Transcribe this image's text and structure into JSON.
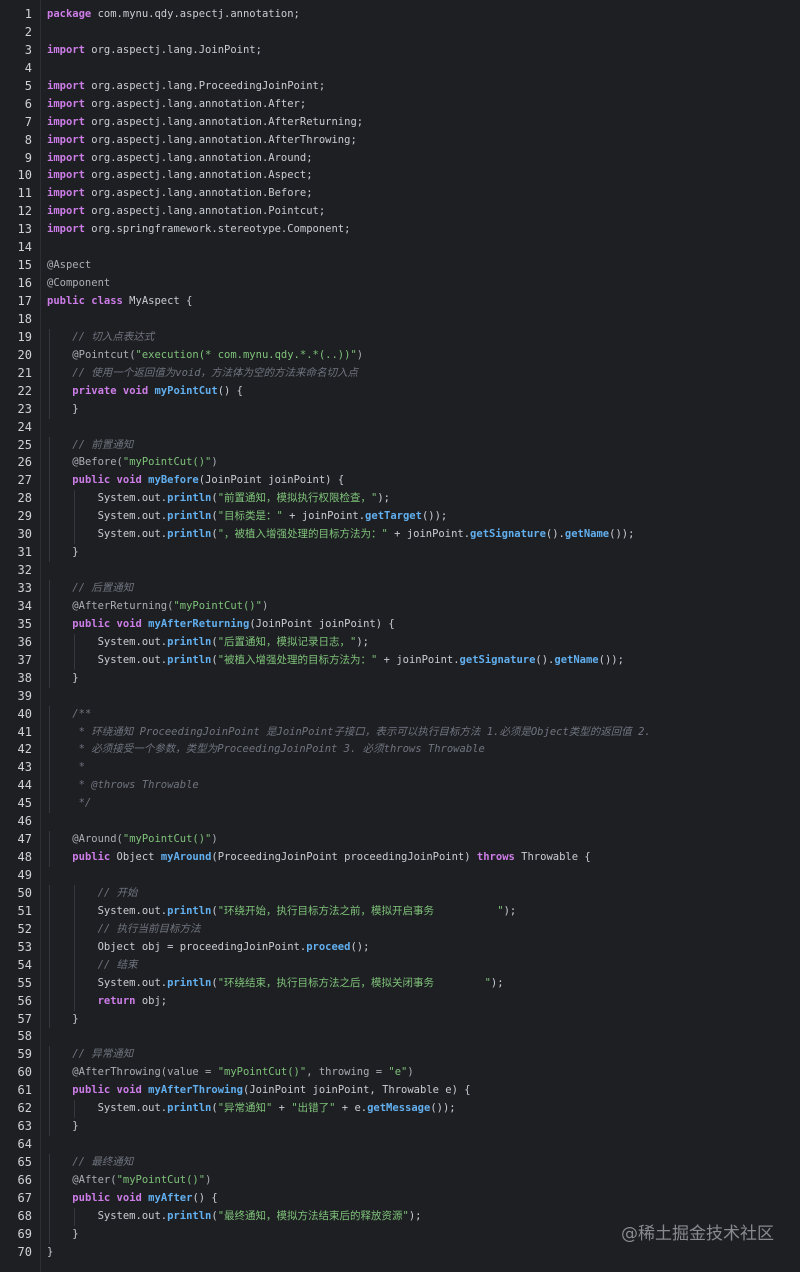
{
  "editor": {
    "language": "java",
    "theme_colors": {
      "background": "#1e1f22",
      "keyword": "#cc7de8",
      "string": "#7ec27a",
      "comment": "#6f7480",
      "method": "#61afef",
      "text": "#c8ccd4",
      "line_number": "#cfd2d6"
    },
    "lines": [
      [
        {
          "t": "package",
          "c": "kw"
        },
        {
          "t": " com.mynu.qdy.aspectj.annotation;"
        }
      ],
      [],
      [
        {
          "t": "import",
          "c": "kw"
        },
        {
          "t": " org.aspectj.lang.JoinPoint;"
        }
      ],
      [],
      [
        {
          "t": "import",
          "c": "kw"
        },
        {
          "t": " org.aspectj.lang.ProceedingJoinPoint;"
        }
      ],
      [
        {
          "t": "import",
          "c": "kw"
        },
        {
          "t": " org.aspectj.lang.annotation.After;"
        }
      ],
      [
        {
          "t": "import",
          "c": "kw"
        },
        {
          "t": " org.aspectj.lang.annotation.AfterReturning;"
        }
      ],
      [
        {
          "t": "import",
          "c": "kw"
        },
        {
          "t": " org.aspectj.lang.annotation.AfterThrowing;"
        }
      ],
      [
        {
          "t": "import",
          "c": "kw"
        },
        {
          "t": " org.aspectj.lang.annotation.Around;"
        }
      ],
      [
        {
          "t": "import",
          "c": "kw"
        },
        {
          "t": " org.aspectj.lang.annotation.Aspect;"
        }
      ],
      [
        {
          "t": "import",
          "c": "kw"
        },
        {
          "t": " org.aspectj.lang.annotation.Before;"
        }
      ],
      [
        {
          "t": "import",
          "c": "kw"
        },
        {
          "t": " org.aspectj.lang.annotation.Pointcut;"
        }
      ],
      [
        {
          "t": "import",
          "c": "kw"
        },
        {
          "t": " org.springframework.stereotype.Component;"
        }
      ],
      [],
      [
        {
          "t": "@Aspect",
          "c": "ann"
        }
      ],
      [
        {
          "t": "@Component",
          "c": "ann"
        }
      ],
      [
        {
          "t": "public class",
          "c": "kw"
        },
        {
          "t": " MyAspect {"
        }
      ],
      [],
      [
        {
          "t": "    "
        },
        {
          "t": "// 切入点表达式",
          "c": "com"
        }
      ],
      [
        {
          "t": "    "
        },
        {
          "t": "@Pointcut(",
          "c": "ann"
        },
        {
          "t": "\"execution(* com.mynu.qdy.*.*(..))\"",
          "c": "str"
        },
        {
          "t": ")",
          "c": "ann"
        }
      ],
      [
        {
          "t": "    "
        },
        {
          "t": "// 使用一个返回值为void，方法体为空的方法来命名切入点",
          "c": "com"
        }
      ],
      [
        {
          "t": "    "
        },
        {
          "t": "private void",
          "c": "kw"
        },
        {
          "t": " "
        },
        {
          "t": "myPointCut",
          "c": "fn"
        },
        {
          "t": "() {"
        }
      ],
      [
        {
          "t": "    }"
        }
      ],
      [],
      [
        {
          "t": "    "
        },
        {
          "t": "// 前置通知",
          "c": "com"
        }
      ],
      [
        {
          "t": "    "
        },
        {
          "t": "@Before(",
          "c": "ann"
        },
        {
          "t": "\"myPointCut()\"",
          "c": "str"
        },
        {
          "t": ")",
          "c": "ann"
        }
      ],
      [
        {
          "t": "    "
        },
        {
          "t": "public void",
          "c": "kw"
        },
        {
          "t": " "
        },
        {
          "t": "myBefore",
          "c": "fn"
        },
        {
          "t": "(JoinPoint joinPoint) {"
        }
      ],
      [
        {
          "t": "        System.out."
        },
        {
          "t": "println",
          "c": "fn"
        },
        {
          "t": "("
        },
        {
          "t": "\"前置通知，模拟执行权限检查，\"",
          "c": "str"
        },
        {
          "t": ");"
        }
      ],
      [
        {
          "t": "        System.out."
        },
        {
          "t": "println",
          "c": "fn"
        },
        {
          "t": "("
        },
        {
          "t": "\"目标类是：\"",
          "c": "str"
        },
        {
          "t": " + joinPoint."
        },
        {
          "t": "getTarget",
          "c": "fn"
        },
        {
          "t": "());"
        }
      ],
      [
        {
          "t": "        System.out."
        },
        {
          "t": "println",
          "c": "fn"
        },
        {
          "t": "("
        },
        {
          "t": "\"，被植入增强处理的目标方法为：\"",
          "c": "str"
        },
        {
          "t": " + joinPoint."
        },
        {
          "t": "getSignature",
          "c": "fn"
        },
        {
          "t": "()."
        },
        {
          "t": "getName",
          "c": "fn"
        },
        {
          "t": "());"
        }
      ],
      [
        {
          "t": "    }"
        }
      ],
      [],
      [
        {
          "t": "    "
        },
        {
          "t": "// 后置通知",
          "c": "com"
        }
      ],
      [
        {
          "t": "    "
        },
        {
          "t": "@AfterReturning(",
          "c": "ann"
        },
        {
          "t": "\"myPointCut()\"",
          "c": "str"
        },
        {
          "t": ")",
          "c": "ann"
        }
      ],
      [
        {
          "t": "    "
        },
        {
          "t": "public void",
          "c": "kw"
        },
        {
          "t": " "
        },
        {
          "t": "myAfterReturning",
          "c": "fn"
        },
        {
          "t": "(JoinPoint joinPoint) {"
        }
      ],
      [
        {
          "t": "        System.out."
        },
        {
          "t": "println",
          "c": "fn"
        },
        {
          "t": "("
        },
        {
          "t": "\"后置通知，模拟记录日志，\"",
          "c": "str"
        },
        {
          "t": ");"
        }
      ],
      [
        {
          "t": "        System.out."
        },
        {
          "t": "println",
          "c": "fn"
        },
        {
          "t": "("
        },
        {
          "t": "\"被植入增强处理的目标方法为：\"",
          "c": "str"
        },
        {
          "t": " + joinPoint."
        },
        {
          "t": "getSignature",
          "c": "fn"
        },
        {
          "t": "()."
        },
        {
          "t": "getName",
          "c": "fn"
        },
        {
          "t": "());"
        }
      ],
      [
        {
          "t": "    }"
        }
      ],
      [],
      [
        {
          "t": "    "
        },
        {
          "t": "/**",
          "c": "com"
        }
      ],
      [
        {
          "t": "     "
        },
        {
          "t": "* 环绕通知 ProceedingJoinPoint 是JoinPoint子接口，表示可以执行目标方法 1.必须是Object类型的返回值 2.",
          "c": "com"
        }
      ],
      [
        {
          "t": "     "
        },
        {
          "t": "* 必须接受一个参数，类型为ProceedingJoinPoint 3. 必须throws Throwable",
          "c": "com"
        }
      ],
      [
        {
          "t": "     "
        },
        {
          "t": "*",
          "c": "com"
        }
      ],
      [
        {
          "t": "     "
        },
        {
          "t": "* @throws Throwable",
          "c": "com"
        }
      ],
      [
        {
          "t": "     "
        },
        {
          "t": "*/",
          "c": "com"
        }
      ],
      [],
      [
        {
          "t": "    "
        },
        {
          "t": "@Around(",
          "c": "ann"
        },
        {
          "t": "\"myPointCut()\"",
          "c": "str"
        },
        {
          "t": ")",
          "c": "ann"
        }
      ],
      [
        {
          "t": "    "
        },
        {
          "t": "public",
          "c": "kw"
        },
        {
          "t": " Object "
        },
        {
          "t": "myAround",
          "c": "fn"
        },
        {
          "t": "(ProceedingJoinPoint proceedingJoinPoint) "
        },
        {
          "t": "throws",
          "c": "kw"
        },
        {
          "t": " Throwable {"
        }
      ],
      [],
      [
        {
          "t": "        "
        },
        {
          "t": "// 开始",
          "c": "com"
        }
      ],
      [
        {
          "t": "        System.out."
        },
        {
          "t": "println",
          "c": "fn"
        },
        {
          "t": "("
        },
        {
          "t": "\"环绕开始，执行目标方法之前，模拟开启事务          \"",
          "c": "str"
        },
        {
          "t": ");"
        }
      ],
      [
        {
          "t": "        "
        },
        {
          "t": "// 执行当前目标方法",
          "c": "com"
        }
      ],
      [
        {
          "t": "        Object obj = proceedingJoinPoint."
        },
        {
          "t": "proceed",
          "c": "fn"
        },
        {
          "t": "();"
        }
      ],
      [
        {
          "t": "        "
        },
        {
          "t": "// 结束",
          "c": "com"
        }
      ],
      [
        {
          "t": "        System.out."
        },
        {
          "t": "println",
          "c": "fn"
        },
        {
          "t": "("
        },
        {
          "t": "\"环绕结束，执行目标方法之后，模拟关闭事务        \"",
          "c": "str"
        },
        {
          "t": ");"
        }
      ],
      [
        {
          "t": "        "
        },
        {
          "t": "return",
          "c": "kw"
        },
        {
          "t": " obj;"
        }
      ],
      [
        {
          "t": "    }"
        }
      ],
      [],
      [
        {
          "t": "    "
        },
        {
          "t": "// 异常通知",
          "c": "com"
        }
      ],
      [
        {
          "t": "    "
        },
        {
          "t": "@AfterThrowing(value = ",
          "c": "ann"
        },
        {
          "t": "\"myPointCut()\"",
          "c": "str"
        },
        {
          "t": ", throwing = ",
          "c": "ann"
        },
        {
          "t": "\"e\"",
          "c": "str"
        },
        {
          "t": ")",
          "c": "ann"
        }
      ],
      [
        {
          "t": "    "
        },
        {
          "t": "public void",
          "c": "kw"
        },
        {
          "t": " "
        },
        {
          "t": "myAfterThrowing",
          "c": "fn"
        },
        {
          "t": "(JoinPoint joinPoint, Throwable e) {"
        }
      ],
      [
        {
          "t": "        System.out."
        },
        {
          "t": "println",
          "c": "fn"
        },
        {
          "t": "("
        },
        {
          "t": "\"异常通知\"",
          "c": "str"
        },
        {
          "t": " + "
        },
        {
          "t": "\"出错了\"",
          "c": "str"
        },
        {
          "t": " + e."
        },
        {
          "t": "getMessage",
          "c": "fn"
        },
        {
          "t": "());"
        }
      ],
      [
        {
          "t": "    }"
        }
      ],
      [],
      [
        {
          "t": "    "
        },
        {
          "t": "// 最终通知",
          "c": "com"
        }
      ],
      [
        {
          "t": "    "
        },
        {
          "t": "@After(",
          "c": "ann"
        },
        {
          "t": "\"myPointCut()\"",
          "c": "str"
        },
        {
          "t": ")",
          "c": "ann"
        }
      ],
      [
        {
          "t": "    "
        },
        {
          "t": "public void",
          "c": "kw"
        },
        {
          "t": " "
        },
        {
          "t": "myAfter",
          "c": "fn"
        },
        {
          "t": "() {"
        }
      ],
      [
        {
          "t": "        System.out."
        },
        {
          "t": "println",
          "c": "fn"
        },
        {
          "t": "("
        },
        {
          "t": "\"最终通知，模拟方法结束后的释放资源\"",
          "c": "str"
        },
        {
          "t": ");"
        }
      ],
      [
        {
          "t": "    }"
        }
      ],
      [
        {
          "t": "}"
        }
      ]
    ]
  },
  "watermark": "@稀土掘金技术社区"
}
